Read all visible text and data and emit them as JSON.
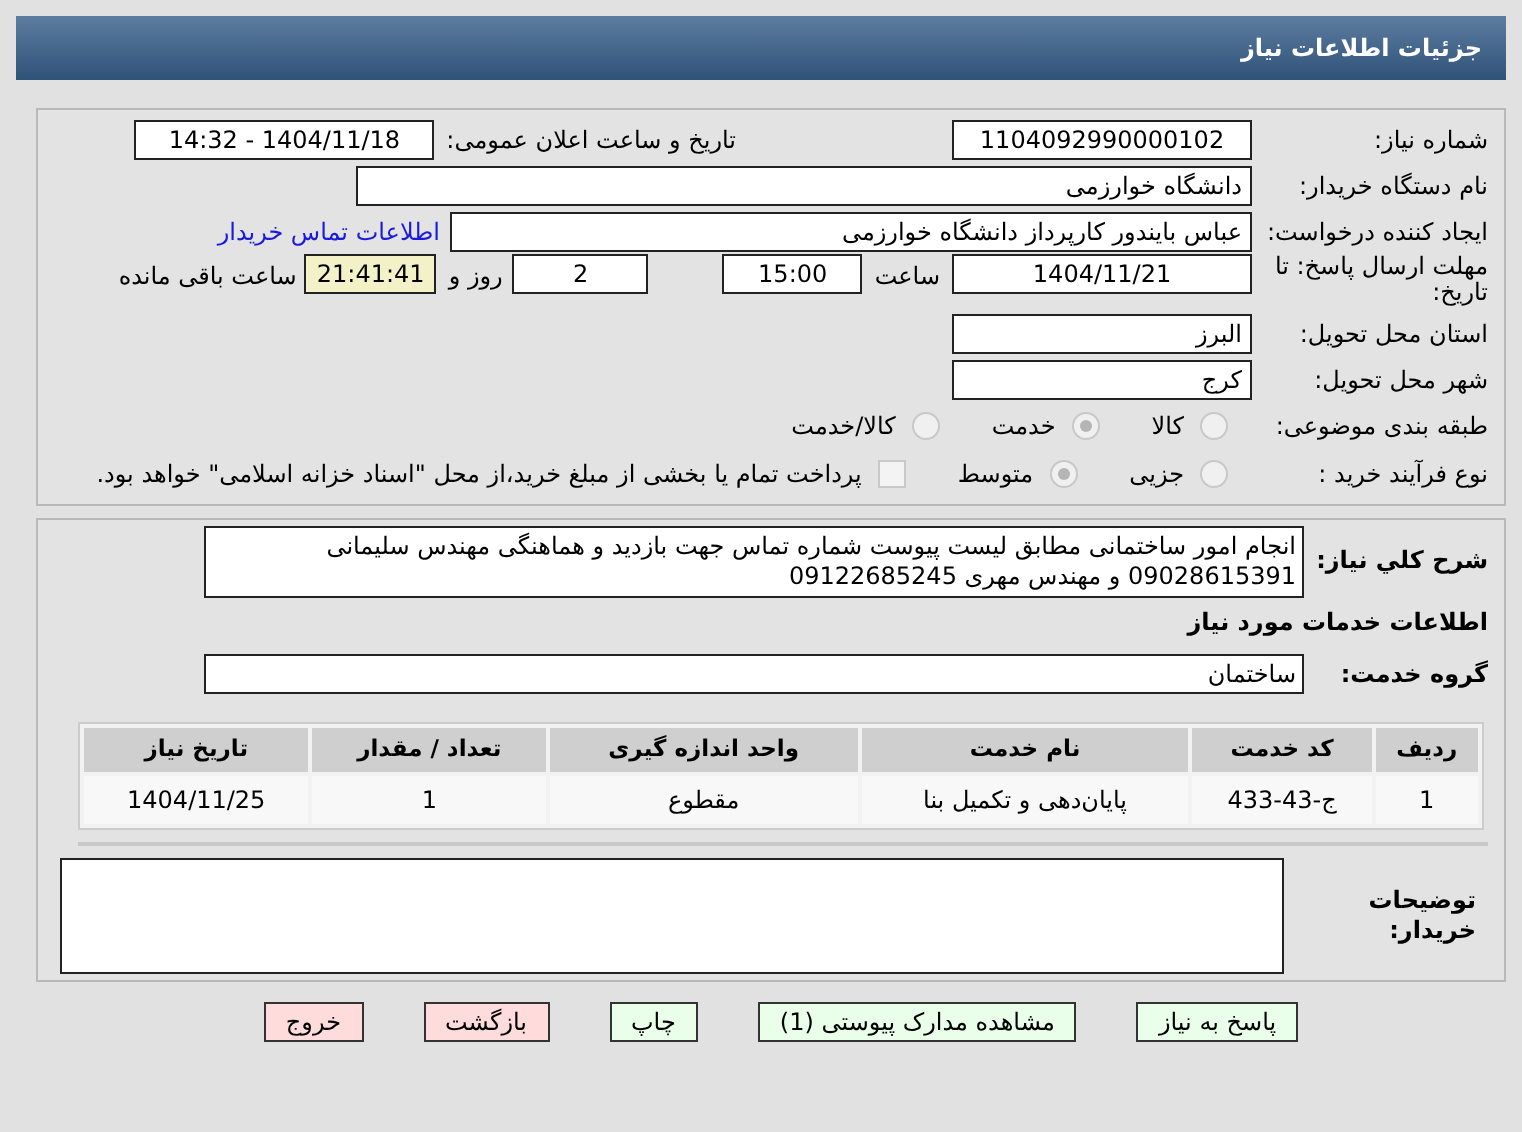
{
  "page_title": "جزئیات اطلاعات نیاز",
  "need_number": {
    "label": "شماره نیاز:",
    "value": "1104092990000102"
  },
  "announce": {
    "label": "تاریخ و ساعت اعلان عمومی:",
    "value": "1404/11/18 - 14:32"
  },
  "buyer_org": {
    "label": "نام دستگاه خریدار:",
    "value": "دانشگاه خوارزمی"
  },
  "requester": {
    "label": "ایجاد کننده درخواست:",
    "value": "عباس بایندور کارپرداز دانشگاه خوارزمی",
    "link": "اطلاعات تماس خریدار"
  },
  "deadline": {
    "label": "مهلت ارسال پاسخ: تا تاریخ:",
    "date": "1404/11/21",
    "time_label": "ساعت",
    "time": "15:00",
    "days": "2",
    "days_label": "روز و",
    "remaining": "21:41:41",
    "remaining_label": "ساعت باقی مانده"
  },
  "province": {
    "label": "استان محل تحویل:",
    "value": "البرز"
  },
  "city": {
    "label": "شهر محل تحویل:",
    "value": "کرج"
  },
  "category": {
    "label": "طبقه بندی موضوعی:",
    "options": [
      {
        "label": "کالا",
        "selected": false
      },
      {
        "label": "خدمت",
        "selected": true
      },
      {
        "label": "کالا/خدمت",
        "selected": false
      }
    ]
  },
  "process": {
    "label": "نوع فرآیند خرید :",
    "options": [
      {
        "label": "جزیی",
        "selected": false
      },
      {
        "label": "متوسط",
        "selected": true
      }
    ],
    "payment": {
      "checked": false,
      "text": "پرداخت تمام یا بخشی از مبلغ خرید،از محل \"اسناد خزانه اسلامی\" خواهد بود."
    }
  },
  "description": {
    "label": "شرح کلي نياز:",
    "value": "انجام امور ساختمانی مطابق لیست پیوست شماره تماس جهت بازدید و هماهنگی مهندس سلیمانی 09028615391 و مهندس مهری 09122685245"
  },
  "services_title": "اطلاعات خدمات مورد نیاز",
  "service_group": {
    "label": "گروه خدمت:",
    "value": "ساختمان"
  },
  "table": {
    "columns": [
      "ردیف",
      "کد خدمت",
      "نام خدمت",
      "واحد اندازه گیری",
      "تعداد / مقدار",
      "تاریخ نیاز"
    ],
    "rows": [
      [
        "1",
        "ج-43-433",
        "پایان‌دهی و تکمیل بنا",
        "مقطوع",
        "1",
        "1404/11/25"
      ]
    ]
  },
  "buyer_notes": {
    "label": "توضیحات خریدار:"
  },
  "buttons": [
    {
      "label": "پاسخ به نیاز",
      "kind": "action"
    },
    {
      "label": "مشاهده مدارک پیوستی (1)",
      "kind": "action"
    },
    {
      "label": "چاپ",
      "kind": "action"
    },
    {
      "label": "بازگشت",
      "kind": "exit"
    },
    {
      "label": "خروج",
      "kind": "exit"
    }
  ]
}
